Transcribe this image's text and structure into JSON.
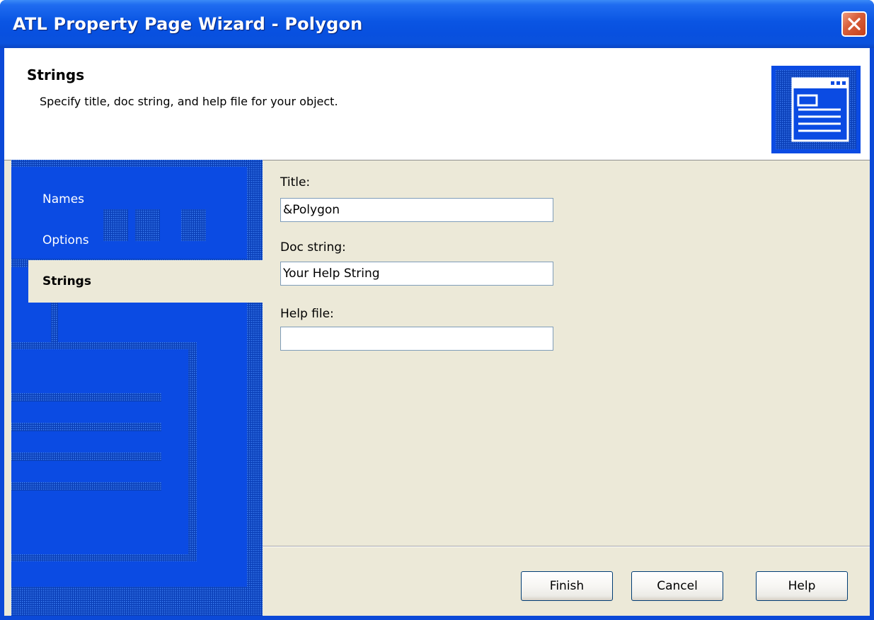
{
  "window": {
    "title": "ATL Property Page Wizard - Polygon"
  },
  "header": {
    "title": "Strings",
    "subtitle": "Specify title, doc string, and help file for your object."
  },
  "sidebar": {
    "items": [
      {
        "label": "Names",
        "selected": false
      },
      {
        "label": "Options",
        "selected": false
      },
      {
        "label": "Strings",
        "selected": true
      }
    ]
  },
  "form": {
    "title_label": "Title:",
    "title_value": "&Polygon",
    "docstring_label": "Doc string:",
    "docstring_value": "Your Help String",
    "helpfile_label": "Help file:",
    "helpfile_value": ""
  },
  "buttons": {
    "finish": "Finish",
    "cancel": "Cancel",
    "help": "Help"
  },
  "icons": {
    "close": "close-icon",
    "header": "property-page-icon"
  },
  "colors": {
    "titlebar": "#0a55e3",
    "sidebar": "#0b4be3",
    "dialog_face": "#ece9d8",
    "close_button": "#d8603c"
  }
}
